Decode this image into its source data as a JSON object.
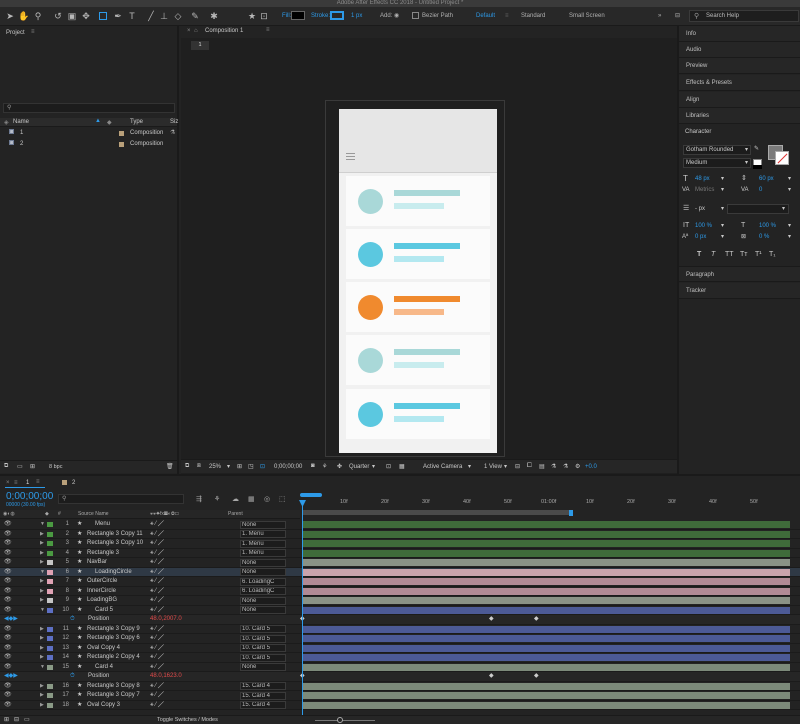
{
  "app_title": "Adobe After Effects CC 2018 - Untitled Project *",
  "toolbar": {
    "fill_label": "Fill:",
    "stroke_label": "Stroke:",
    "stroke_width": "1 px",
    "add_label": "Add:",
    "bezier_label": "Bezier Path",
    "workspaces": [
      "Default",
      "Standard",
      "Small Screen"
    ],
    "search_placeholder": "Search Help"
  },
  "project": {
    "title": "Project",
    "search_placeholder": "",
    "columns": [
      "Name",
      "Type",
      "Siz"
    ],
    "items": [
      {
        "name": "1",
        "type": "Composition"
      },
      {
        "name": "2",
        "type": "Composition"
      }
    ],
    "bpc": "8 bpc"
  },
  "composition": {
    "tab": "Composition 1",
    "breadcrumb": "1",
    "zoom": "25%",
    "timecode": "0;00;00;00",
    "resolution": "Quarter",
    "camera": "Active Camera",
    "views": "1 View",
    "exposure": "+0.0"
  },
  "right_panels": {
    "items": [
      "Info",
      "Audio",
      "Preview",
      "Effects & Presets",
      "Align",
      "Libraries"
    ],
    "character_title": "Character",
    "font": "Gotham Rounded",
    "style": "Medium",
    "font_size": "48 px",
    "leading": "60 px",
    "kerning": "Metrics",
    "tracking": "0",
    "stroke_px": "- px",
    "vscale": "100 %",
    "hscale": "100 %",
    "baseline": "0 px",
    "tsume": "0 %",
    "text_styles": [
      "T",
      "T",
      "TT",
      "Tт",
      "T¹",
      "T₁"
    ],
    "paragraph": "Paragraph",
    "tracker": "Tracker"
  },
  "timeline": {
    "tabs": [
      "1",
      "2"
    ],
    "timecode": "0;00;00;00",
    "fps": "00000 (30.00 fps)",
    "columns": {
      "source": "Source Name",
      "parent": "Parent"
    },
    "ruler": [
      "10f",
      "20f",
      "01:00f",
      "10f",
      "20f",
      "30f",
      "40f",
      "50f",
      "10f",
      "20f",
      "30f",
      "40f",
      "50f",
      "10f"
    ],
    "ruler_labels": [
      "10f",
      "20f",
      "30f",
      "40f",
      "50f",
      "01:00f",
      "10f",
      "20f",
      "30f",
      "40f",
      "50f"
    ],
    "toggle_label": "Toggle Switches / Modes",
    "layers": [
      {
        "num": "1",
        "name": "Menu",
        "parent": "None",
        "color": "#4b9a42",
        "bar": "#3f6b3a",
        "expand": true,
        "shape": true
      },
      {
        "num": "2",
        "name": "Rectangle 3 Copy 11",
        "parent": "1. Menu",
        "color": "#4b9a42",
        "bar": "#3f6b3a"
      },
      {
        "num": "3",
        "name": "Rectangle 3 Copy 10",
        "parent": "1. Menu",
        "color": "#4b9a42",
        "bar": "#3f6b3a"
      },
      {
        "num": "4",
        "name": "Rectangle 3",
        "parent": "1. Menu",
        "color": "#4b9a42",
        "bar": "#3f6b3a"
      },
      {
        "num": "5",
        "name": "NavBar",
        "parent": "None",
        "color": "#c5c5c5",
        "bar": "#8a9286"
      },
      {
        "num": "6",
        "name": "LoadingCircle",
        "parent": "None",
        "color": "#e0a2b4",
        "bar": "#c9a3ac",
        "expand": true,
        "shape": true,
        "selected": true
      },
      {
        "num": "7",
        "name": "OuterCircle",
        "parent": "6. LoadingC",
        "color": "#e0a2b4",
        "bar": "#b18a95"
      },
      {
        "num": "8",
        "name": "InnerCircle",
        "parent": "6. LoadingC",
        "color": "#e0a2b4",
        "bar": "#b18a95"
      },
      {
        "num": "9",
        "name": "LoadingBG",
        "parent": "None",
        "color": "#c5c5c5",
        "bar": "#8a9286"
      },
      {
        "num": "10",
        "name": "Card 5",
        "parent": "None",
        "color": "#5d6fc3",
        "bar": "#4c5a96",
        "expand": true,
        "shape": true
      }
    ],
    "position_rows": [
      {
        "label": "Position",
        "value": "48.0,2007.0"
      },
      {
        "label": "Position",
        "value": "48.0,1623.0"
      }
    ],
    "layers_b": [
      {
        "num": "11",
        "name": "Rectangle 3 Copy 9",
        "parent": "10. Card 5",
        "color": "#5d6fc3",
        "bar": "#4c5a96"
      },
      {
        "num": "12",
        "name": "Rectangle 3 Copy 6",
        "parent": "10. Card 5",
        "color": "#5d6fc3",
        "bar": "#4c5a96"
      },
      {
        "num": "13",
        "name": "Oval Copy 4",
        "parent": "10. Card 5",
        "color": "#5d6fc3",
        "bar": "#4c5a96"
      },
      {
        "num": "14",
        "name": "Rectangle 2 Copy 4",
        "parent": "10. Card 5",
        "color": "#5d6fc3",
        "bar": "#4c5a96"
      },
      {
        "num": "15",
        "name": "Card 4",
        "parent": "None",
        "color": "#8a9a86",
        "bar": "#7c8a7a",
        "expand": true,
        "shape": true
      }
    ],
    "layers_c": [
      {
        "num": "16",
        "name": "Rectangle 3 Copy 8",
        "parent": "15. Card 4",
        "color": "#8a9a86",
        "bar": "#7c8a7a"
      },
      {
        "num": "17",
        "name": "Rectangle 3 Copy 7",
        "parent": "15. Card 4",
        "color": "#8a9a86",
        "bar": "#7c8a7a"
      },
      {
        "num": "18",
        "name": "Oval Copy 3",
        "parent": "15. Card 4",
        "color": "#8a9a86",
        "bar": "#7c8a7a"
      }
    ]
  },
  "cards": [
    {
      "circle": "#a9d8d8",
      "bar1": "#a9d8d8",
      "bar2": "#c8ecee"
    },
    {
      "circle": "#5bc8e0",
      "bar1": "#5bc8e0",
      "bar2": "#b3e8f0"
    },
    {
      "circle": "#f08a2e",
      "bar1": "#f08a2e",
      "bar2": "#f7b889"
    },
    {
      "circle": "#a9d8d8",
      "bar1": "#a9d8d8",
      "bar2": "#c8ecee"
    },
    {
      "circle": "#5bc8e0",
      "bar1": "#5bc8e0",
      "bar2": "#b3e8f0"
    }
  ]
}
